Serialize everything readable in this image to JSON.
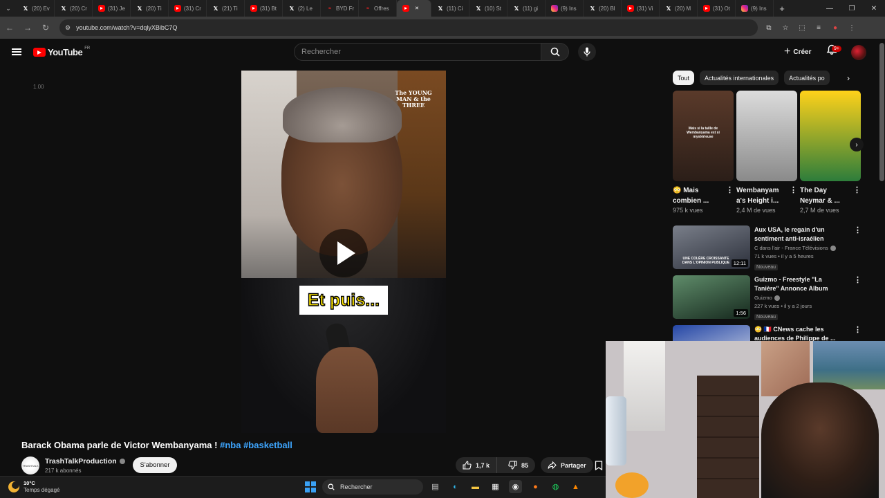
{
  "browser": {
    "tabs": [
      {
        "label": "(20) Ev",
        "icon": "x-icon"
      },
      {
        "label": "(20) Cr",
        "icon": "x-icon"
      },
      {
        "label": "(31) Je",
        "icon": "youtube-icon"
      },
      {
        "label": "(20) Ti",
        "icon": "x-icon"
      },
      {
        "label": "(31) Cr",
        "icon": "youtube-icon"
      },
      {
        "label": "(21) Ti",
        "icon": "x-icon"
      },
      {
        "label": "(31) Bt",
        "icon": "youtube-icon"
      },
      {
        "label": "(2) Le",
        "icon": "x-icon"
      },
      {
        "label": "BYD Fr",
        "icon": "byd-icon"
      },
      {
        "label": "Offres",
        "icon": "byd-icon"
      },
      {
        "label": "",
        "icon": "youtube-icon",
        "active": true
      },
      {
        "label": "(11) Ci",
        "icon": "x-icon"
      },
      {
        "label": "(10) St",
        "icon": "x-icon"
      },
      {
        "label": "(11) gi",
        "icon": "x-icon"
      },
      {
        "label": "(9) Ins",
        "icon": "instagram-icon"
      },
      {
        "label": "(20) Bl",
        "icon": "x-icon"
      },
      {
        "label": "(31) Vi",
        "icon": "youtube-icon"
      },
      {
        "label": "(20) M",
        "icon": "x-icon"
      },
      {
        "label": "(31) Ot",
        "icon": "youtube-icon"
      },
      {
        "label": "(9) Ins",
        "icon": "instagram-icon"
      }
    ],
    "new_tab": "+",
    "url": "youtube.com/watch?v=dqlyXBibC7Q"
  },
  "youtube": {
    "logo_text": "YouTube",
    "logo_country": "FR",
    "search_placeholder": "Rechercher",
    "create_label": "Créer",
    "notif_badge": "9+"
  },
  "player": {
    "speed": "1.00",
    "watermark": "The YOUNG MAN & the THREE",
    "caption": "Et puis..."
  },
  "video": {
    "title": "Barack Obama parle de Victor Wembanyama !",
    "hashtags": "#nba #basketball",
    "channel_name": "TrashTalkProduction",
    "channel_avatar_text": "TRASHTALK",
    "subscribers": "217 k abonnés",
    "subscribe_label": "S'abonner",
    "likes": "1,7 k",
    "dislikes": "85",
    "share_label": "Partager"
  },
  "sidebar": {
    "chips": [
      {
        "label": "Tout",
        "active": true
      },
      {
        "label": "Actualités internationales"
      },
      {
        "label": "Actualités po"
      }
    ],
    "shorts": [
      {
        "title": "😳 Mais combien ...",
        "views": "975 k vues",
        "thumb_text": "Mais si la taille de Wembanyama est si mystérieuse",
        "colors": [
          "#5a3a2a",
          "#2b1e18"
        ]
      },
      {
        "title": "Wembanyam a's Height i...",
        "views": "2,4 M de vues",
        "colors": [
          "#dcdcdc",
          "#8a8a8a"
        ]
      },
      {
        "title": "The Day Neymar & ...",
        "views": "2,7 M de vues",
        "colors": [
          "#ffd21a",
          "#2d7d3b"
        ]
      }
    ],
    "recommendations": [
      {
        "title": "Aux USA, le regain d'un sentiment anti-israélien",
        "channel": "C dans l'air - France Télévisions",
        "verified": true,
        "meta": "71 k vues • il y a 5 heures",
        "duration": "12:11",
        "badge": "Nouveau",
        "thumb_text": "UNE COLÈRE CROISSANTE DANS L'OPINION PUBLIQUE",
        "colors": [
          "#7a7f8a",
          "#2b2f3a"
        ]
      },
      {
        "title": "Guizmo - Freestyle \"La Tanière\" Annonce Album",
        "channel": "Guizmo",
        "verified": true,
        "meta": "227 k vues • il y a 2 jours",
        "duration": "1:56",
        "badge": "Nouveau",
        "colors": [
          "#5f8c6a",
          "#16291e"
        ]
      },
      {
        "title": "😳 🇫🇷 CNews cache les audiences de Philippe de ...",
        "channel": "",
        "verified": false,
        "meta": "",
        "duration": "",
        "badge": "",
        "colors": [
          "#2446a6",
          "#d8dde8"
        ]
      }
    ]
  },
  "taskbar": {
    "temperature": "10°C",
    "weather": "Temps dégagé",
    "search_label": "Rechercher"
  }
}
